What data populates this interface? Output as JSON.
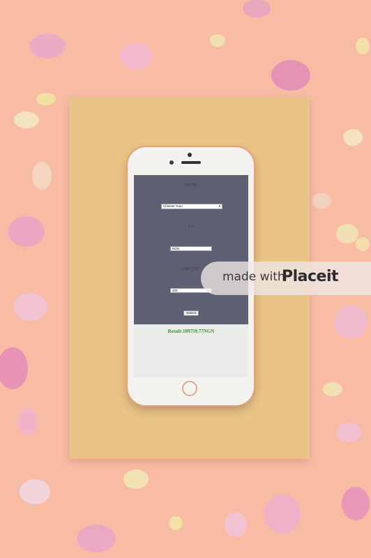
{
  "form": {
    "from_label": "FROM",
    "from_value": "Chinese Yuan",
    "to_label": "TO",
    "to_value": "NGN",
    "amount_label": "AMOUNT",
    "amount_value": "300",
    "submit_label": "Submit",
    "result_text": "Result:109759.77NGN"
  },
  "watermark": {
    "prefix": "made with",
    "brand": "Placeit"
  },
  "icons": {
    "select_arrow": "chevron-down-icon"
  },
  "colors": {
    "background": "#f8bca4",
    "board": "#e9c486",
    "form_panel": "#5d5f72",
    "result": "#4a8a3a"
  }
}
